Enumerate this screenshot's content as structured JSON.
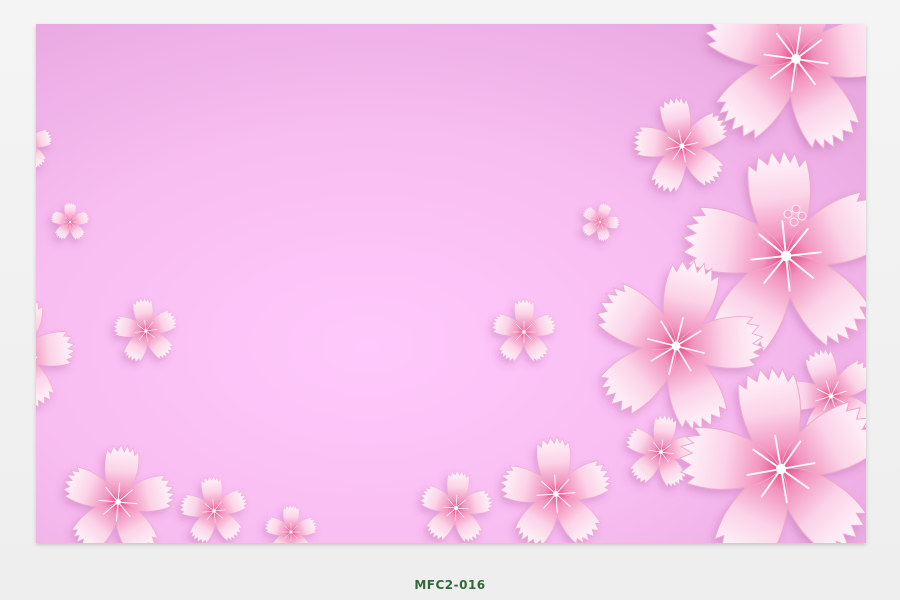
{
  "artwork": {
    "subject": "floral-wallpaper",
    "background_color_center": "#ffc8fb",
    "background_color_edge": "#ecaee4",
    "petal_light": "#fff3f9",
    "petal_mid": "#f7bfdc",
    "petal_accent": "#e7578f",
    "stamen_color": "#ffffff"
  },
  "product_code": "MFC2-016"
}
